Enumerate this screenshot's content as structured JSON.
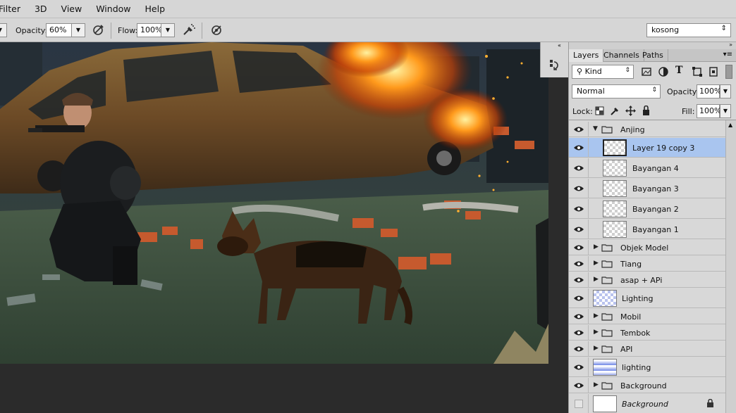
{
  "menu": [
    "Filter",
    "3D",
    "View",
    "Window",
    "Help"
  ],
  "options": {
    "opacity_label": "Opacity:",
    "opacity_value": "60%",
    "flow_label": "Flow:",
    "flow_value": "100%",
    "preset_value": "kosong"
  },
  "panel": {
    "tabs": [
      "Layers",
      "Channels",
      "Paths"
    ],
    "filter_kind": "Kind",
    "blend_mode": "Normal",
    "opacity_label": "Opacity:",
    "opacity_value": "100%",
    "lock_label": "Lock:",
    "fill_label": "Fill:",
    "fill_value": "100%"
  },
  "layers": [
    {
      "name": "Anjing",
      "type": "group",
      "expanded": true
    },
    {
      "name": "Layer 19 copy 3",
      "type": "layer",
      "indent": true,
      "selected": true
    },
    {
      "name": "Bayangan 4",
      "type": "layer",
      "indent": true
    },
    {
      "name": "Bayangan 3",
      "type": "layer",
      "indent": true
    },
    {
      "name": "Bayangan 2",
      "type": "layer",
      "indent": true
    },
    {
      "name": "Bayangan 1",
      "type": "layer",
      "indent": true
    },
    {
      "name": "Objek Model",
      "type": "group"
    },
    {
      "name": "Tiang",
      "type": "group"
    },
    {
      "name": "asap + APi",
      "type": "group"
    },
    {
      "name": "Lighting",
      "type": "layer"
    },
    {
      "name": "Mobil",
      "type": "group"
    },
    {
      "name": "Tembok",
      "type": "group"
    },
    {
      "name": "API",
      "type": "group"
    },
    {
      "name": "lighting",
      "type": "layer"
    },
    {
      "name": "Background",
      "type": "group"
    },
    {
      "name": "Background",
      "type": "background",
      "italic": true,
      "locked": true
    }
  ]
}
